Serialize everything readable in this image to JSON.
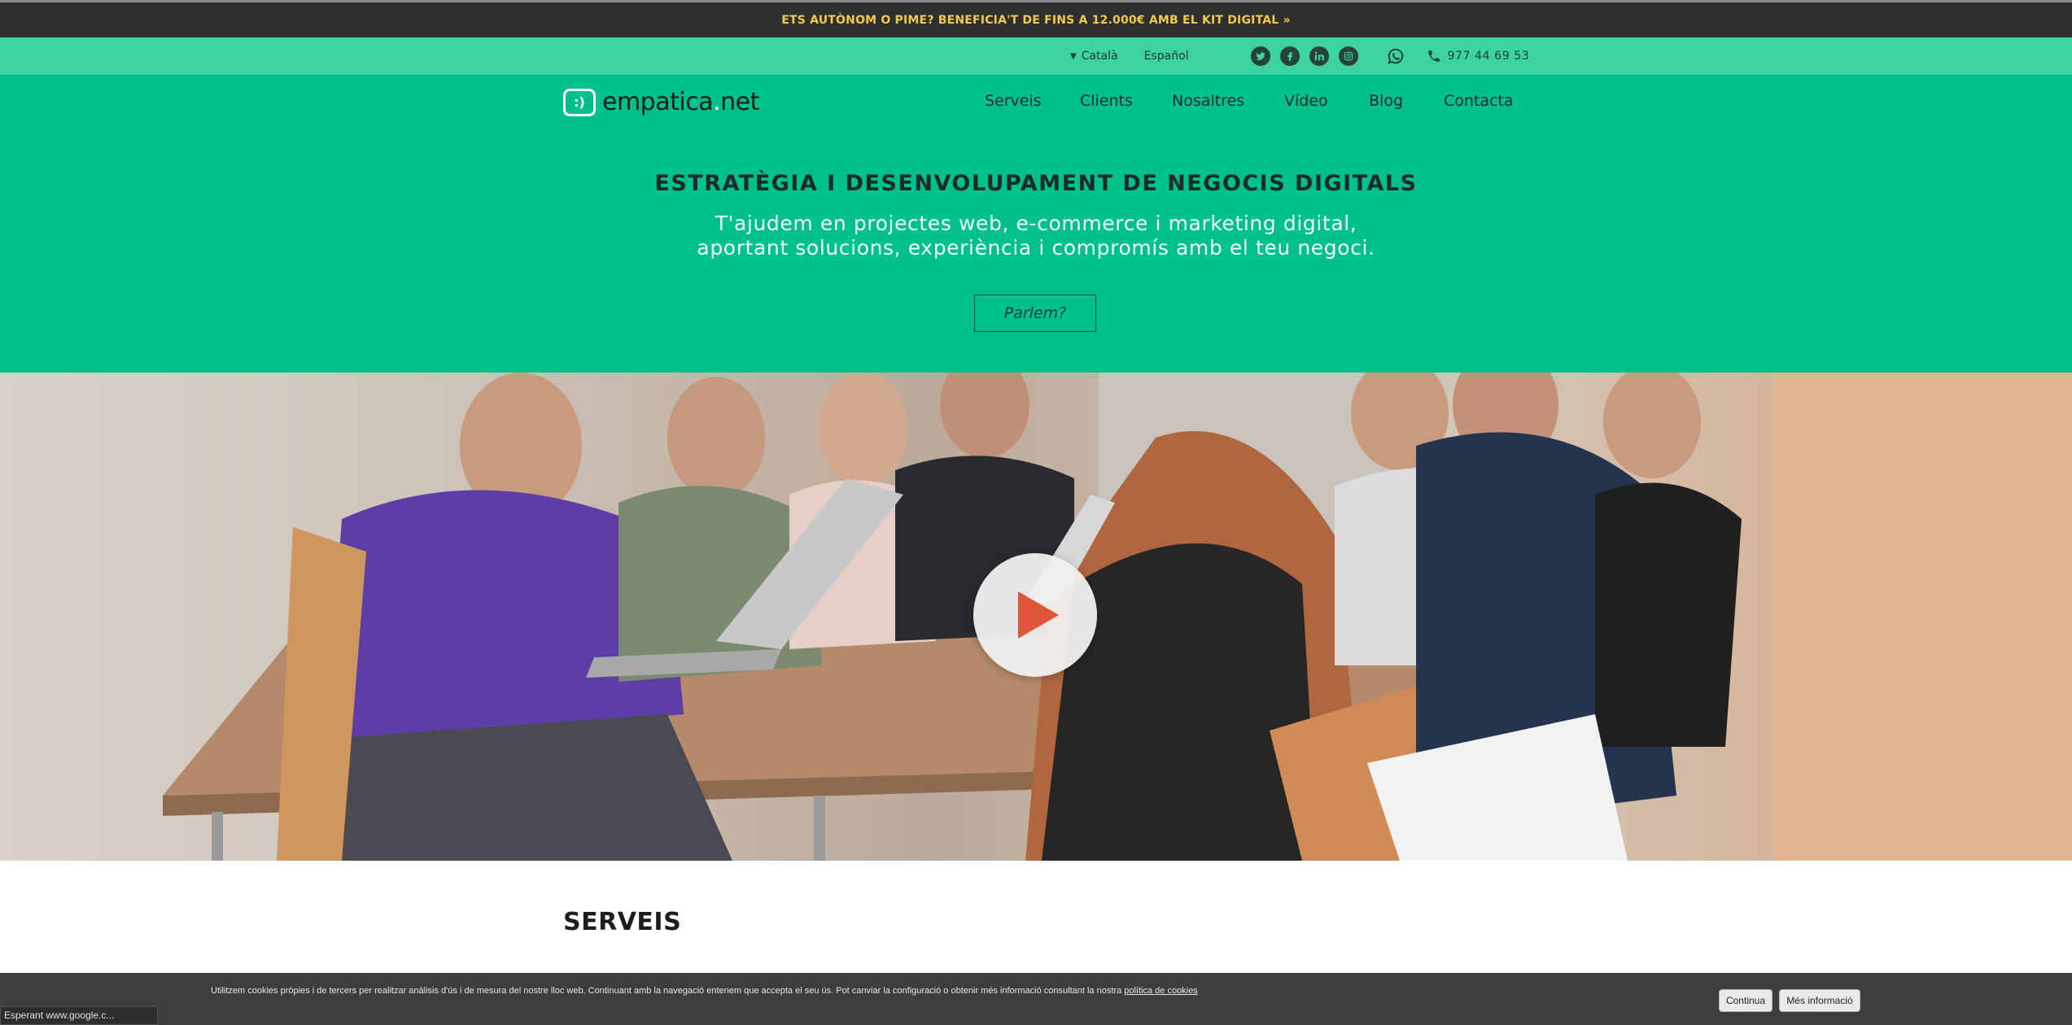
{
  "promo": {
    "text": "ETS AUTÒNOM O PIME? BENEFICIA'T DE FINS A 12.000€ AMB EL KIT DIGITAL »"
  },
  "utility": {
    "languages": [
      "Català",
      "Español"
    ],
    "social_icons": [
      "twitter-icon",
      "facebook-icon",
      "linkedin-icon",
      "instagram-icon"
    ],
    "whatsapp_icon": "whatsapp-icon",
    "phone": "977 44 69 53"
  },
  "header": {
    "logo_mark": ":)",
    "logo_name": "empatica",
    "logo_dot": ".",
    "logo_tld": "net",
    "nav": [
      "Serveis",
      "Clients",
      "Nosaltres",
      "Vídeo",
      "Blog",
      "Contacta"
    ]
  },
  "hero": {
    "title": "ESTRATÈGIA I DESENVOLUPAMENT DE NEGOCIS DIGITALS",
    "subtitle_line1": "T'ajudem en projectes web, e-commerce i marketing digital,",
    "subtitle_line2": "aportant solucions, experiència i compromís amb el teu negoci.",
    "cta": "Parlem?"
  },
  "services": {
    "title": "SERVEIS"
  },
  "cookie": {
    "text": "Utilitzem cookies pròpies i de tercers per realitzar anàlisis d'ús i de mesura del nostre lloc web. Continuant amb la navegació entenem que accepta el seu ús. Pot canviar la configuració o obtenir més informació consultant la nostra",
    "link": "política de cookies",
    "accept": "Continua",
    "more": "Més informació"
  },
  "status_bar": {
    "text": "Esperant www.google.c..."
  },
  "colors": {
    "brand_green": "#00c08b",
    "utility_green": "#3dd3a0",
    "promo_yellow": "#f2c94c"
  }
}
